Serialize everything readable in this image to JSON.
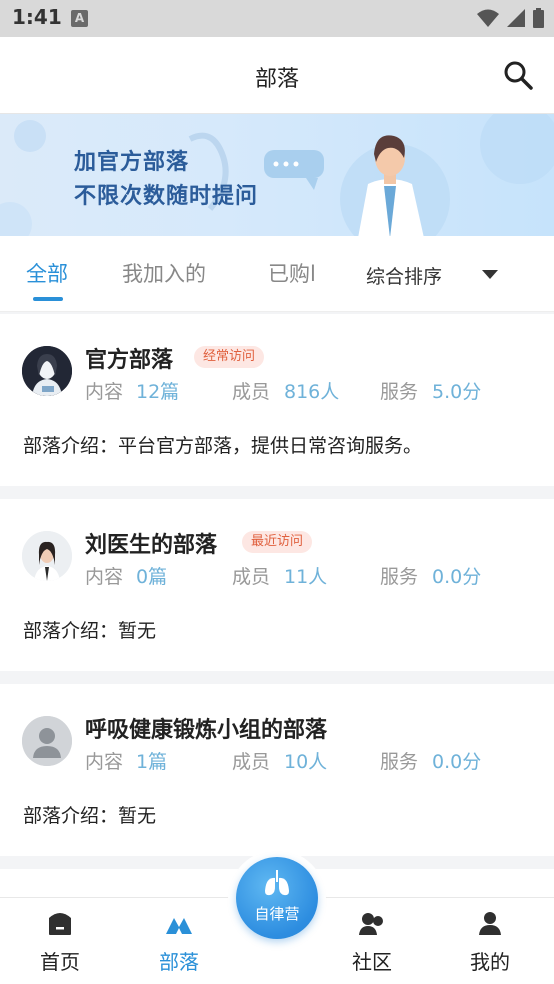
{
  "status_bar": {
    "time": "1:41",
    "notification_letter": "A"
  },
  "header": {
    "title": "部落"
  },
  "banner": {
    "line1": "加官方部落",
    "line2": "不限次数随时提问"
  },
  "tabs": [
    {
      "label": "全部",
      "active": true
    },
    {
      "label": "我加入的",
      "active": false
    },
    {
      "label": "已购l",
      "active": false
    }
  ],
  "sort": {
    "label": "综合排序"
  },
  "stat_labels": {
    "content": "内容",
    "members": "成员",
    "service": "服务"
  },
  "intro_label": "部落介绍：",
  "tribes": [
    {
      "name": "官方部落",
      "badge": "经常访问",
      "content": "12篇",
      "members": "816人",
      "service": "5.0分",
      "intro": "平台官方部落，提供日常咨询服务。"
    },
    {
      "name": "刘医生的部落",
      "badge": "最近访问",
      "content": "0篇",
      "members": "11人",
      "service": "0.0分",
      "intro": "暂无"
    },
    {
      "name": "呼吸健康锻炼小组的部落",
      "badge": "",
      "content": "1篇",
      "members": "10人",
      "service": "0.0分",
      "intro": "暂无"
    }
  ],
  "bottom_nav": {
    "home": "首页",
    "tribe": "部落",
    "center": "自律营",
    "community": "社区",
    "mine": "我的"
  },
  "colors": {
    "accent": "#2a90d8",
    "badge_bg": "#fde7e3",
    "badge_text": "#e0603e",
    "stat_value": "#6fb2d9"
  }
}
